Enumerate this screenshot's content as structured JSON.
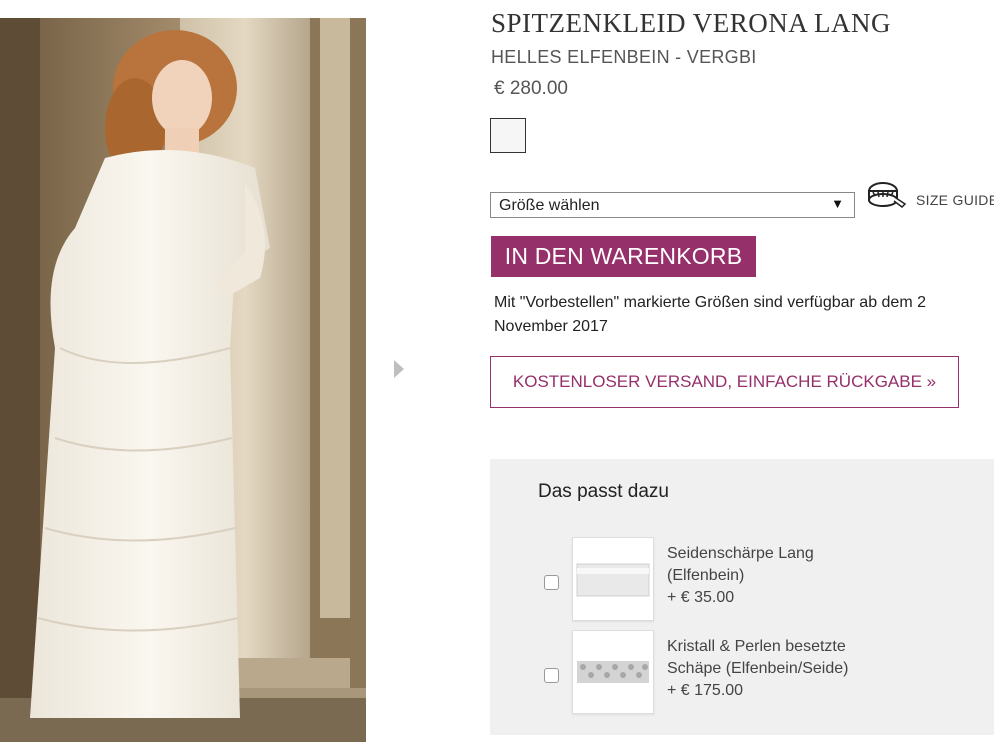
{
  "product": {
    "title": "SPITZENKLEID VERONA LANG",
    "color_name": "HELLES ELFENBEIN - VERGBI",
    "price": "€ 280.00",
    "swatch_color": "#f6f6f6"
  },
  "size_selector": {
    "selected": "Größe wählen",
    "caret": "▼",
    "size_guide_label": "SIZE GUIDE"
  },
  "cart_button": {
    "label": "IN DEN WARENKORB",
    "color": "#96306a"
  },
  "preorder_note": "Mit \"Vorbestellen\" markierte Größen sind verfügbar ab dem 2 November 2017",
  "shipping_button": {
    "label": "KOSTENLOSER VERSAND, EINFACHE RÜCKGABE »"
  },
  "matches": {
    "title": "Das passt dazu",
    "items": [
      {
        "name": "Seidenschärpe Lang (Elfenbein)",
        "price": "+ € 35.00",
        "thumb_icon": "silk-sash"
      },
      {
        "name": "Kristall & Perlen besetzte Schäpe (Elfenbein/Seide)",
        "price": "+ € 175.00",
        "thumb_icon": "crystal-pearl-sash"
      }
    ]
  }
}
